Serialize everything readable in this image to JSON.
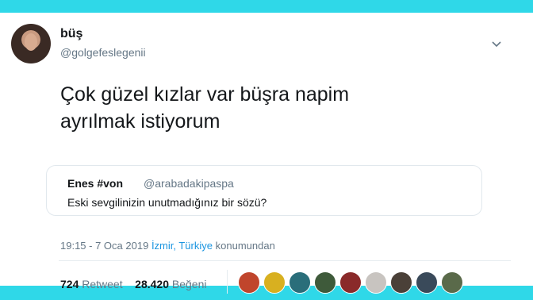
{
  "tweet": {
    "author_name": "büş",
    "author_handle": "@golgefeslegenii",
    "text_line1": "Çok güzel kızlar var büşra napim",
    "text_line2": "ayrılmak istiyorum",
    "quote": {
      "name": "Enes #von",
      "handle": "@arabadakipaspa",
      "text": "Eski sevgilinizin unutmadığınız bir sözü?"
    },
    "meta": {
      "time": "19:15 - 7 Oca 2019",
      "location": "İzmir, Türkiye",
      "suffix": "konumundan"
    },
    "stats": {
      "retweet_count": "724",
      "retweet_label": "Retweet",
      "like_count": "28.420",
      "like_label": "Beğeni"
    }
  },
  "icons": {
    "menu": "chevron-down-icon"
  },
  "colors": {
    "frame": "#2fd8e8",
    "link": "#1b95e0",
    "secondary_text": "#657786"
  }
}
